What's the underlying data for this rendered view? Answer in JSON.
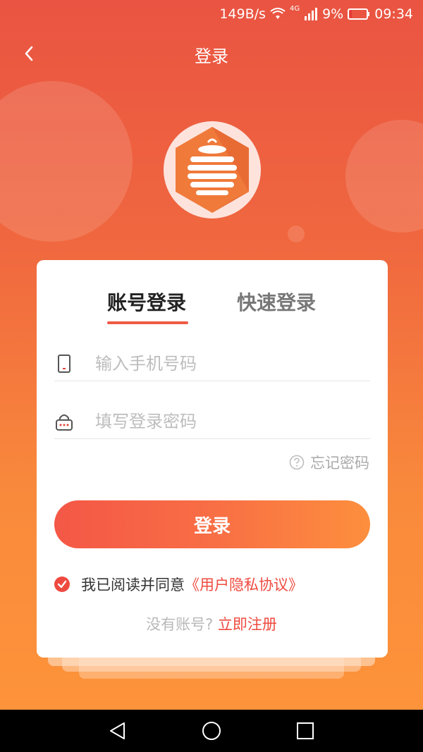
{
  "status_bar": {
    "speed": "149B/s",
    "network": "4G",
    "battery": "9%",
    "time": "09:34"
  },
  "header": {
    "title": "登录",
    "back_icon": "chevron-left-icon"
  },
  "tabs": [
    {
      "label": "账号登录",
      "active": true
    },
    {
      "label": "快速登录",
      "active": false
    }
  ],
  "form": {
    "phone_placeholder": "输入手机号码",
    "phone_value": "",
    "password_placeholder": "填写登录密码",
    "password_value": "",
    "forgot_label": "忘记密码",
    "login_button": "登录"
  },
  "agreement": {
    "checked": true,
    "text": "我已阅读并同意",
    "link": "《用户隐私协议》"
  },
  "register": {
    "text": "没有账号?",
    "link": "立即注册"
  },
  "colors": {
    "accent": "#ee4a3f",
    "gradient_top": "#ea5442",
    "gradient_bottom": "#fd933a",
    "logo_orange": "#f07a3a"
  },
  "system_nav": [
    "back-triangle-icon",
    "home-circle-icon",
    "recents-square-icon"
  ]
}
